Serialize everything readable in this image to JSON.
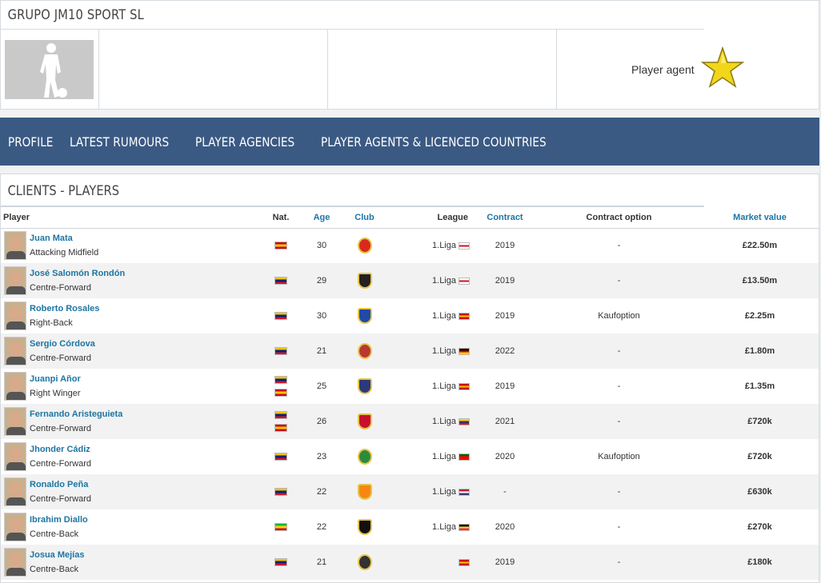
{
  "agency": {
    "name": "GRUPO JM10 SPORT SL",
    "role_label": "Player agent",
    "icons": {
      "photo": "player-silhouette-icon",
      "role": "star-icon"
    }
  },
  "nav": {
    "items": [
      "PROFILE",
      "LATEST RUMOURS",
      "PLAYER AGENCIES",
      "PLAYER AGENTS & LICENCED COUNTRIES"
    ]
  },
  "clients": {
    "title": "CLIENTS - PLAYERS",
    "columns": [
      "Player",
      "Nat.",
      "Age",
      "Club",
      "League",
      "Contract",
      "Contract option",
      "Market value"
    ],
    "rows": [
      {
        "name": "Juan Mata",
        "position": "Attacking Midfield",
        "nat": [
          "ESP"
        ],
        "age": "30",
        "club": "red-devil-crest",
        "league": "1.Liga",
        "league_flag": "ENG",
        "contract": "2019",
        "option": "-",
        "value": "£22.50m"
      },
      {
        "name": "José Salomón Rondón",
        "position": "Centre-Forward",
        "nat": [
          "VEN"
        ],
        "age": "29",
        "club": "magpie-crest",
        "league": "1.Liga",
        "league_flag": "ENG",
        "contract": "2019",
        "option": "-",
        "value": "£13.50m"
      },
      {
        "name": "Roberto Rosales",
        "position": "Right-Back",
        "nat": [
          "VEN"
        ],
        "age": "30",
        "club": "espanyol-crest",
        "league": "1.Liga",
        "league_flag": "ESP",
        "contract": "2019",
        "option": "Kaufoption",
        "value": "£2.25m"
      },
      {
        "name": "Sergio Córdova",
        "position": "Centre-Forward",
        "nat": [
          "VEN"
        ],
        "age": "21",
        "club": "augsburg-crest",
        "league": "1.Liga",
        "league_flag": "GER",
        "contract": "2022",
        "option": "-",
        "value": "£1.80m"
      },
      {
        "name": "Juanpi Añor",
        "position": "Right Winger",
        "nat": [
          "VEN",
          "ESP"
        ],
        "age": "25",
        "club": "huesca-crest",
        "league": "1.Liga",
        "league_flag": "ESP",
        "contract": "2019",
        "option": "-",
        "value": "£1.35m"
      },
      {
        "name": "Fernando Aristeguieta",
        "position": "Centre-Forward",
        "nat": [
          "VEN",
          "ESP"
        ],
        "age": "26",
        "club": "america-cali-crest",
        "league": "1.Liga",
        "league_flag": "COL",
        "contract": "2021",
        "option": "-",
        "value": "£720k"
      },
      {
        "name": "Jhonder Cádiz",
        "position": "Centre-Forward",
        "nat": [
          "VEN"
        ],
        "age": "23",
        "club": "setubal-crest",
        "league": "1.Liga",
        "league_flag": "POR",
        "contract": "2020",
        "option": "Kaufoption",
        "value": "£720k"
      },
      {
        "name": "Ronaldo Peña",
        "position": "Centre-Forward",
        "nat": [
          "VEN"
        ],
        "age": "22",
        "club": "houston-crest",
        "league": "1.Liga",
        "league_flag": "USA",
        "contract": "-",
        "option": "-",
        "value": "£630k"
      },
      {
        "name": "Ibrahim Diallo",
        "position": "Centre-Back",
        "nat": [
          "MLI"
        ],
        "age": "22",
        "club": "eupen-crest",
        "league": "1.Liga",
        "league_flag": "BEL",
        "contract": "2020",
        "option": "-",
        "value": "£270k"
      },
      {
        "name": "Josua Mejías",
        "position": "Centre-Back",
        "nat": [
          "VEN"
        ],
        "age": "21",
        "club": "cartagena-crest",
        "league": "",
        "league_flag": "ESP",
        "contract": "2019",
        "option": "-",
        "value": "£180k"
      }
    ]
  },
  "colors": {
    "nav_bg": "#3b5a83",
    "link": "#1d75a3",
    "flags": {
      "ESP": [
        "#c60b1e",
        "#ffc400",
        "#c60b1e"
      ],
      "VEN": [
        "#f4c300",
        "#00247d",
        "#cf142b"
      ],
      "ENG": [
        "#ffffff",
        "#ce1124",
        "#ffffff"
      ],
      "GER": [
        "#000000",
        "#dd0000",
        "#ffce00"
      ],
      "COL": [
        "#fcd116",
        "#003893",
        "#ce1126"
      ],
      "POR": [
        "#006600",
        "#ff0000",
        "#ff0000"
      ],
      "USA": [
        "#b22234",
        "#ffffff",
        "#3c3b6e"
      ],
      "BEL": [
        "#000000",
        "#fdda24",
        "#ef3340"
      ],
      "MLI": [
        "#14b53a",
        "#fcd116",
        "#ce1126"
      ]
    },
    "crests": {
      "red-devil-crest": "#da291c",
      "magpie-crest": "#241f20",
      "espanyol-crest": "#1f4aa8",
      "augsburg-crest": "#ba3733",
      "huesca-crest": "#2b3a7a",
      "america-cali-crest": "#c8102e",
      "setubal-crest": "#2e8b3a",
      "houston-crest": "#f68712",
      "eupen-crest": "#111111",
      "cartagena-crest": "#333333"
    }
  }
}
